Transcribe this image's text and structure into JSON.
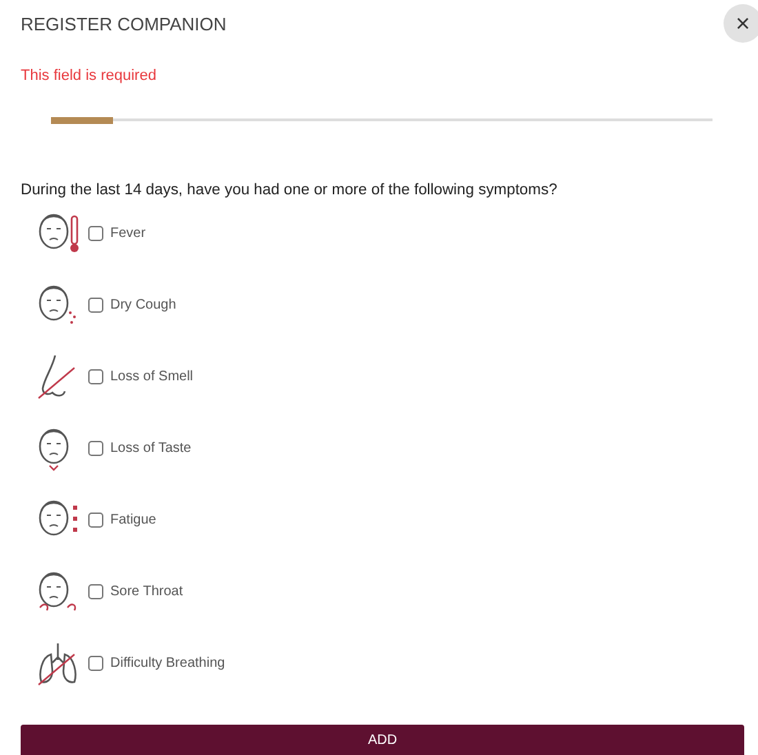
{
  "dialog": {
    "title": "REGISTER COMPANION",
    "close_label": "×"
  },
  "error": "This field is required",
  "progress": {
    "level": 0.094
  },
  "question": "During the last 14 days, have you had one or more of the following symptoms?",
  "symptoms": [
    {
      "label": "Fever",
      "checked": false
    },
    {
      "label": "Dry Cough",
      "checked": false
    },
    {
      "label": "Loss of Smell",
      "checked": false
    },
    {
      "label": "Loss of Taste",
      "checked": false
    },
    {
      "label": "Fatigue",
      "checked": false
    },
    {
      "label": "Sore Throat",
      "checked": false
    },
    {
      "label": "Difficulty Breathing",
      "checked": false
    }
  ],
  "submit": "ADD"
}
